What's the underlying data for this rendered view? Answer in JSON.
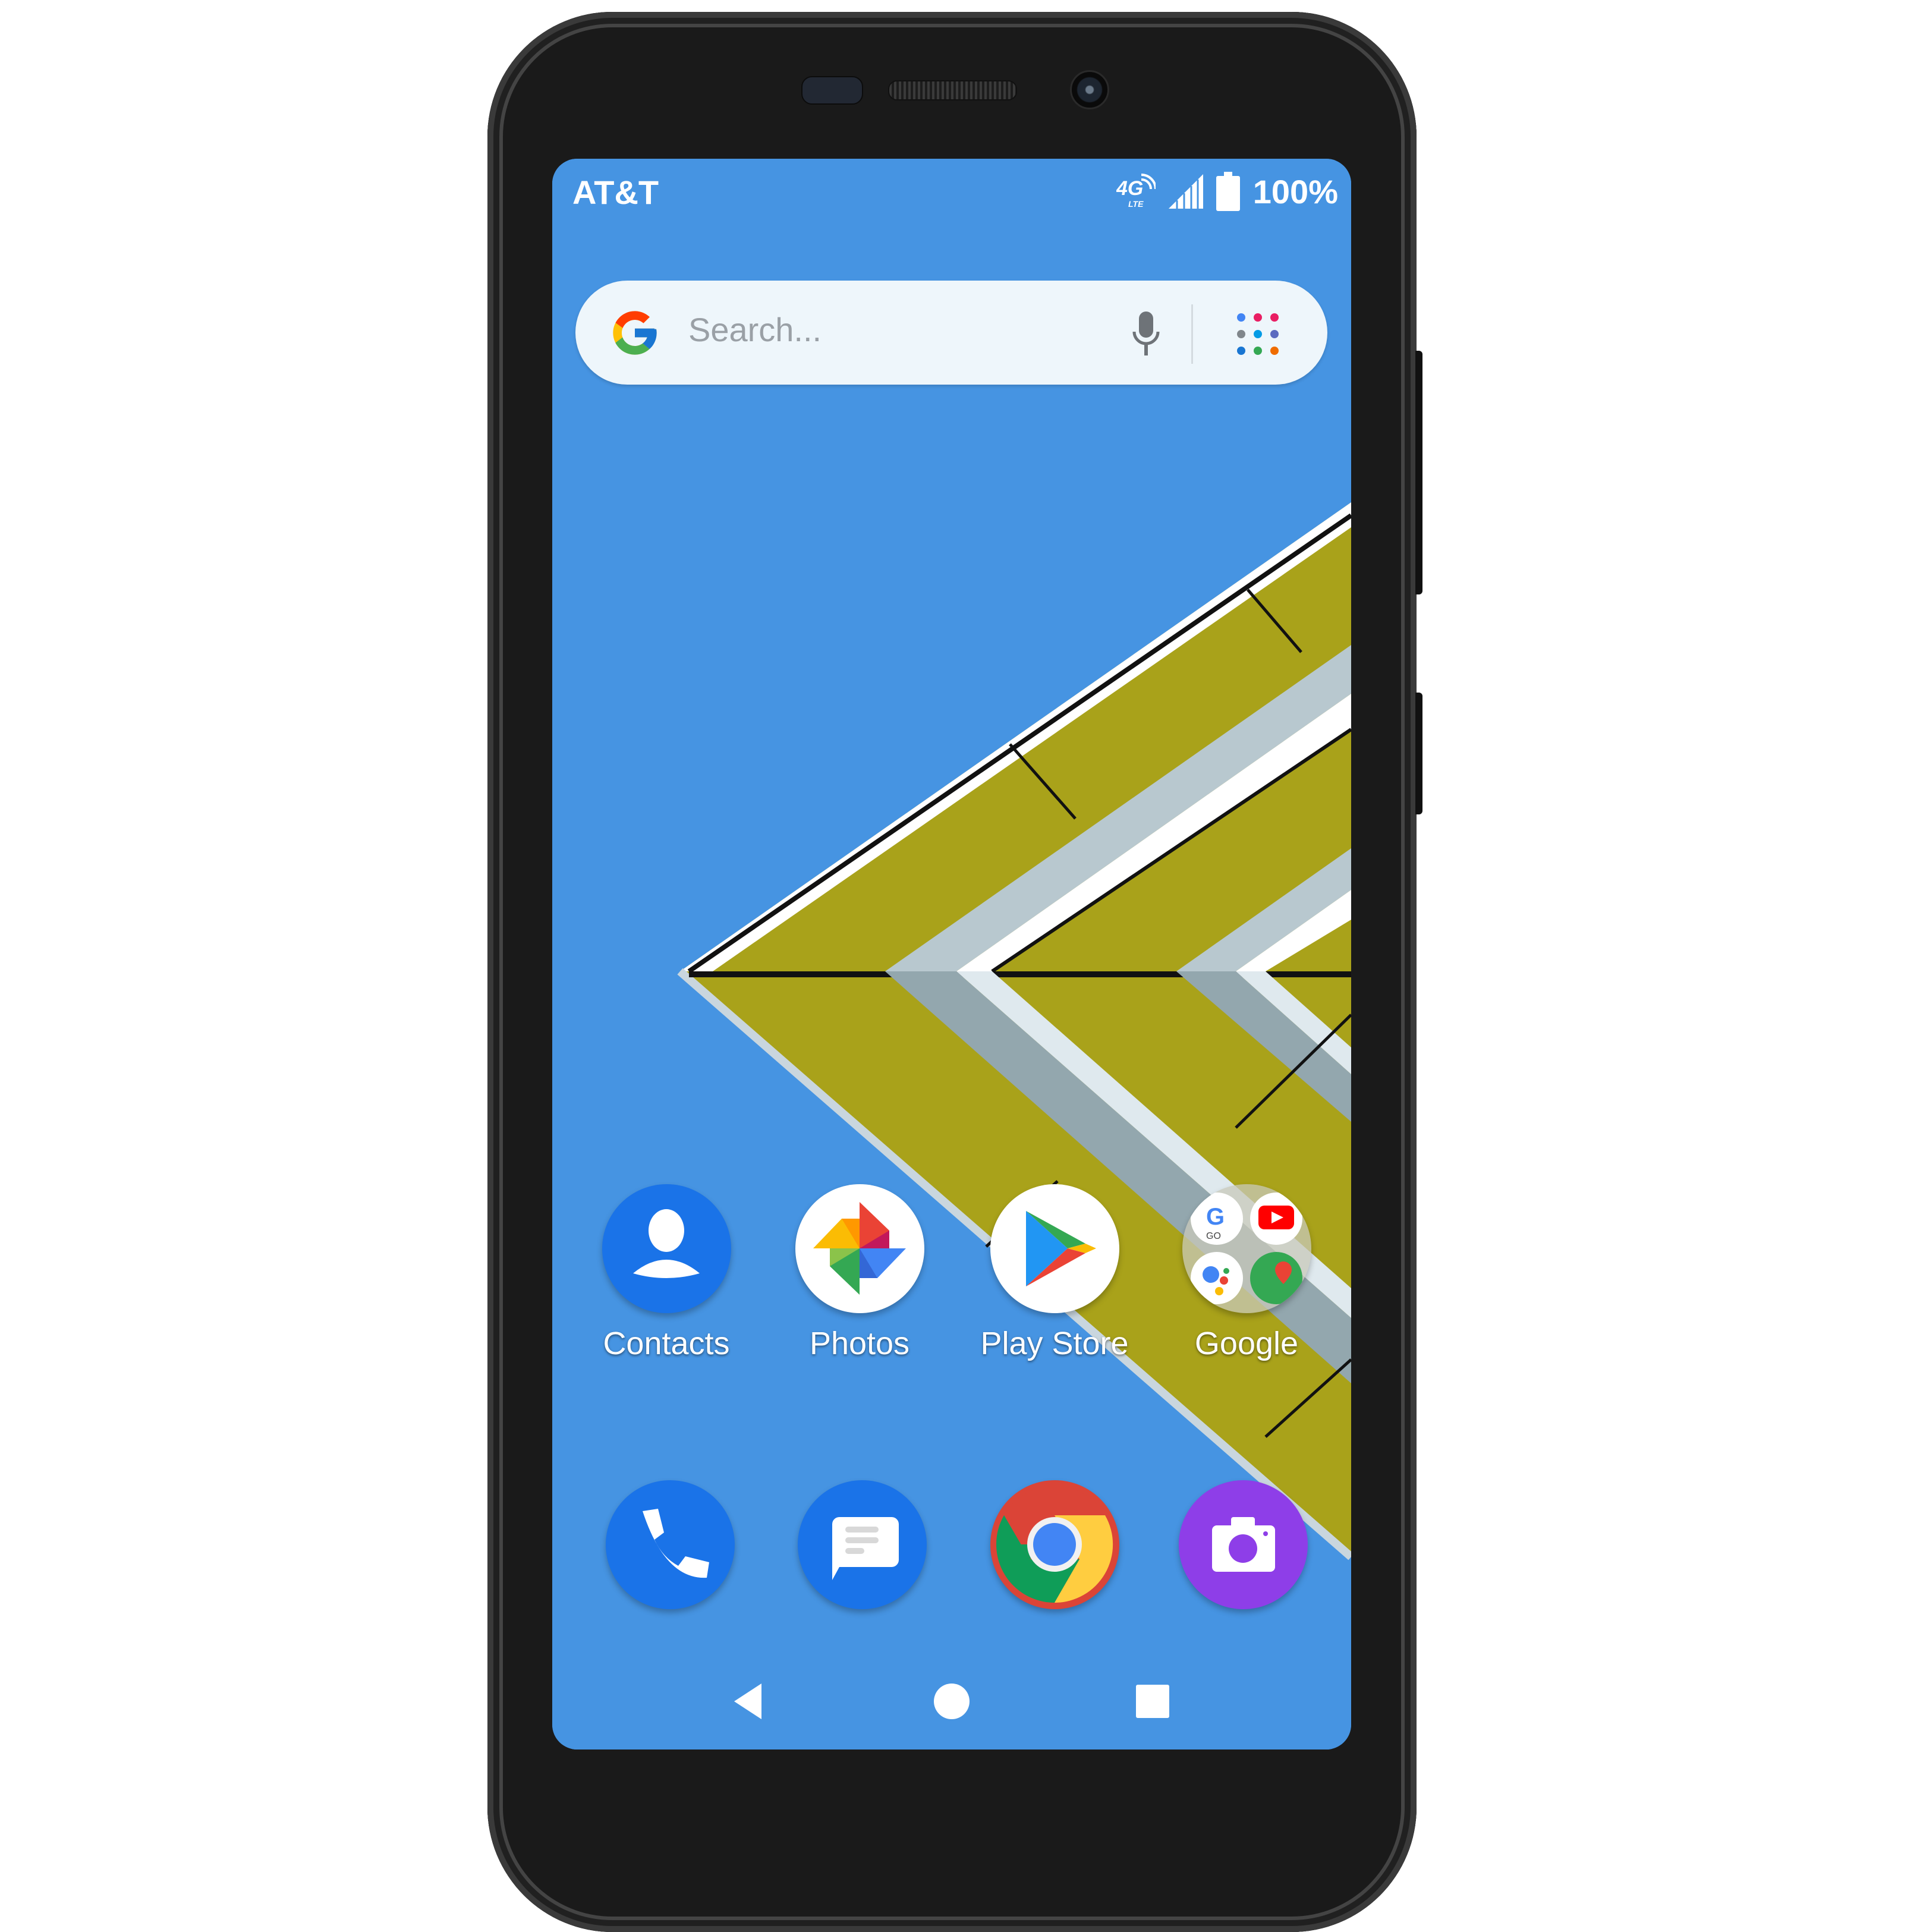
{
  "device": {
    "name": "Android phone home screen"
  },
  "status_bar": {
    "carrier": "AT&T",
    "network": "4G LTE",
    "network_sub": "LTE",
    "signal_icon": "signal-icon",
    "battery_icon": "battery-icon",
    "battery_percent": "100%",
    "battery_level": 1.0
  },
  "search_widget": {
    "placeholder": "Search...",
    "logo": "google-g-icon",
    "voice_icon": "microphone-icon",
    "apps_icon": "app-grid-icon"
  },
  "home_apps": [
    {
      "label": "Contacts",
      "icon": "contacts-icon"
    },
    {
      "label": "Photos",
      "icon": "photos-icon"
    },
    {
      "label": "Play Store",
      "icon": "play-store-icon"
    },
    {
      "label": "Google",
      "icon": "google-folder-icon",
      "folder_items": [
        "Google Go",
        "YouTube",
        "Assistant",
        "Maps"
      ]
    }
  ],
  "dock_apps": [
    {
      "label": "Phone",
      "icon": "phone-icon"
    },
    {
      "label": "Messages",
      "icon": "messages-icon"
    },
    {
      "label": "Chrome",
      "icon": "chrome-icon"
    },
    {
      "label": "Camera",
      "icon": "camera-icon"
    }
  ],
  "nav_bar": {
    "back": "back-icon",
    "home": "home-icon",
    "recents": "recents-icon"
  },
  "colors": {
    "wallpaper_sky": "#4694e2",
    "wallpaper_panel": "#a9a21a",
    "contacts_blue": "#1a73e8",
    "camera_purple": "#8e3ee8"
  }
}
